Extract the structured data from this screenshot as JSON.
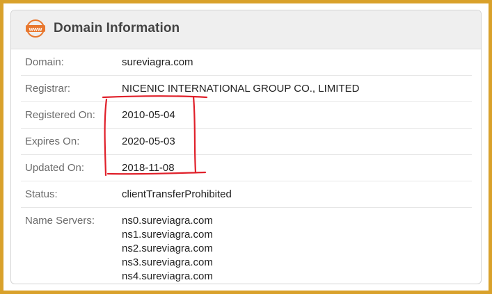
{
  "card": {
    "icon_text": "www",
    "title": "Domain Information"
  },
  "rows": [
    {
      "label": "Domain:",
      "value": "sureviagra.com"
    },
    {
      "label": "Registrar:",
      "value": "NICENIC INTERNATIONAL GROUP CO., LIMITED"
    },
    {
      "label": "Registered On:",
      "value": "2010-05-04"
    },
    {
      "label": "Expires On:",
      "value": "2020-05-03"
    },
    {
      "label": "Updated On:",
      "value": "2018-11-08"
    },
    {
      "label": "Status:",
      "value": "clientTransferProhibited"
    }
  ],
  "name_servers": {
    "label": "Name Servers:",
    "values": [
      "ns0.sureviagra.com",
      "ns1.sureviagra.com",
      "ns2.sureviagra.com",
      "ns3.sureviagra.com",
      "ns4.sureviagra.com"
    ]
  },
  "colors": {
    "border_accent": "#d9a12b",
    "icon_orange": "#e8772e",
    "annotation_red": "#e0202a"
  }
}
